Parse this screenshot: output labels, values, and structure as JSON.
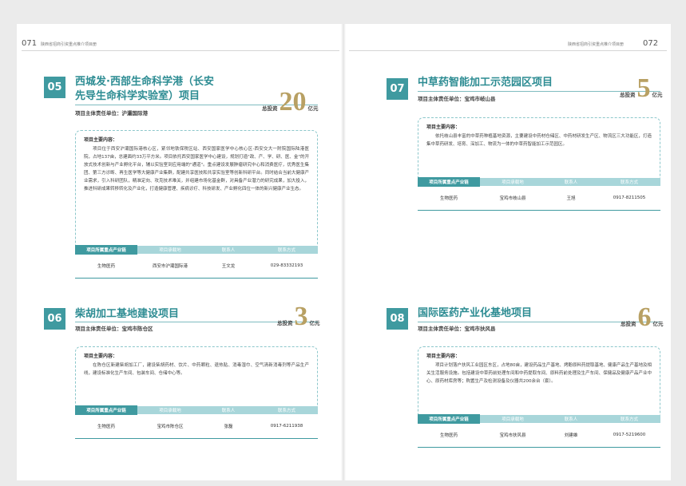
{
  "left_page": {
    "page_number": "071",
    "header": "陕西省招商引资重点推介项目册",
    "projects": [
      {
        "number": "05",
        "title_line1": "西城发·西部生命科学港（长安",
        "title_line2": "先导生命科学实验室）项目",
        "unit_label": "项目主体责任单位：",
        "unit": "沪灞国际港",
        "invest_label": "总投资",
        "invest_value": "20",
        "invest_unit": "亿元",
        "content_label": "项目主要内容：",
        "content": "项目位于西安沪灞国际港核心区，紧邻地铁保税区站、西安国家医学中心核心区-西安交大一附院国际陆港医院，占地137亩，总建面约33万平方米。项目依托西安国家医学中心建设，规划打造\"政、产、学、研、医、金\"的开放式技术创新与产业孵化平台，辅以实验室到应用端的\"通道\"。重点建设发展肿瘤研究中心和消费医疗，优秀医生集团、第三方诊断、再生医学等大健康产业集群，配建共享医技和共享实验室等创新科研平台。同时结合当前大健康产业需求，引入科研团队，精准定向、攻克技术难关，并组建市场化基金群，对具备产业潜力的研究成果，加大投入，推进科研成果转移转化及产业化，打造健康管理、疾病诊疗、科技研发、产业孵化四位一体的新兴健康产业生态。",
        "table_headers": [
          "项目所属重点产业链",
          "项目承载地",
          "联系人",
          "联系方式"
        ],
        "table_row": [
          "生物医药",
          "西安市沪灞国际港",
          "王文龙",
          "029-83332193"
        ]
      },
      {
        "number": "06",
        "title_line1": "柴胡加工基地建设项目",
        "unit_label": "项目主体责任单位：",
        "unit": "宝鸡市陈仓区",
        "invest_label": "总投资",
        "invest_value": "3",
        "invest_unit": "亿元",
        "content_label": "项目主要内容：",
        "content": "在陈仓区新建柴胡加工厂，建设柴胡药材、饮片、中药颗粒、退热贴、消毒湿巾、空气清新消毒剂等产品生产线，建设标准化生产车间、包装车间、仓储中心等。",
        "table_headers": [
          "项目所属重点产业链",
          "项目承载地",
          "联系人",
          "联系方式"
        ],
        "table_row": [
          "生物医药",
          "宝鸡市陈仓区",
          "张磊",
          "0917-6211938"
        ]
      }
    ]
  },
  "right_page": {
    "page_number": "072",
    "header": "陕西省招商引资重点推介项目册",
    "projects": [
      {
        "number": "07",
        "title_line1": "中草药智能加工示范园区项目",
        "unit_label": "项目主体责任单位：",
        "unit": "宝鸡市岐山县",
        "invest_label": "总投资",
        "invest_value": "5",
        "invest_unit": "亿元",
        "content_label": "项目主要内容：",
        "content": "依托岐山县丰富的中草药种植基地资源，主要建设中药材仓储区、中药材研发生产区、物流区三大功能区，打造集中草药研发、培育、深加工、物流为一体的中草药智能加工示范园区。",
        "table_headers": [
          "项目所属重点产业链",
          "项目承载地",
          "联系人",
          "联系方式"
        ],
        "table_row": [
          "生物医药",
          "宝鸡市岐山县",
          "王旭",
          "0917-8211505"
        ]
      },
      {
        "number": "08",
        "title_line1": "国际医药产业化基地项目",
        "unit_label": "项目主体责任单位：",
        "unit": "宝鸡市扶风县",
        "invest_label": "总投资",
        "invest_value": "6",
        "invest_unit": "亿元",
        "content_label": "项目主要内容：",
        "content": "项目计划落户扶风工业园区东区，占地80亩，建设药品生产基地、烤酚原料药提取基地、健康产品生产基地及相关生活服务设施。包括建设中草药前处理车间和中药提取车间、原料药前处理及生产车间、保健品及健康产品产业中心、原药材库房等；购置生产及检测设备及仪器共200余台（套）。",
        "table_headers": [
          "项目所属重点产业链",
          "项目承载地",
          "联系人",
          "联系方式"
        ],
        "table_row": [
          "生物医药",
          "宝鸡市扶风县",
          "刘建雄",
          "0917-5219600"
        ]
      }
    ]
  },
  "colors": {
    "teal": "#3f9aa0",
    "teal_light": "#a8d6da",
    "gold": "#b8a063"
  }
}
